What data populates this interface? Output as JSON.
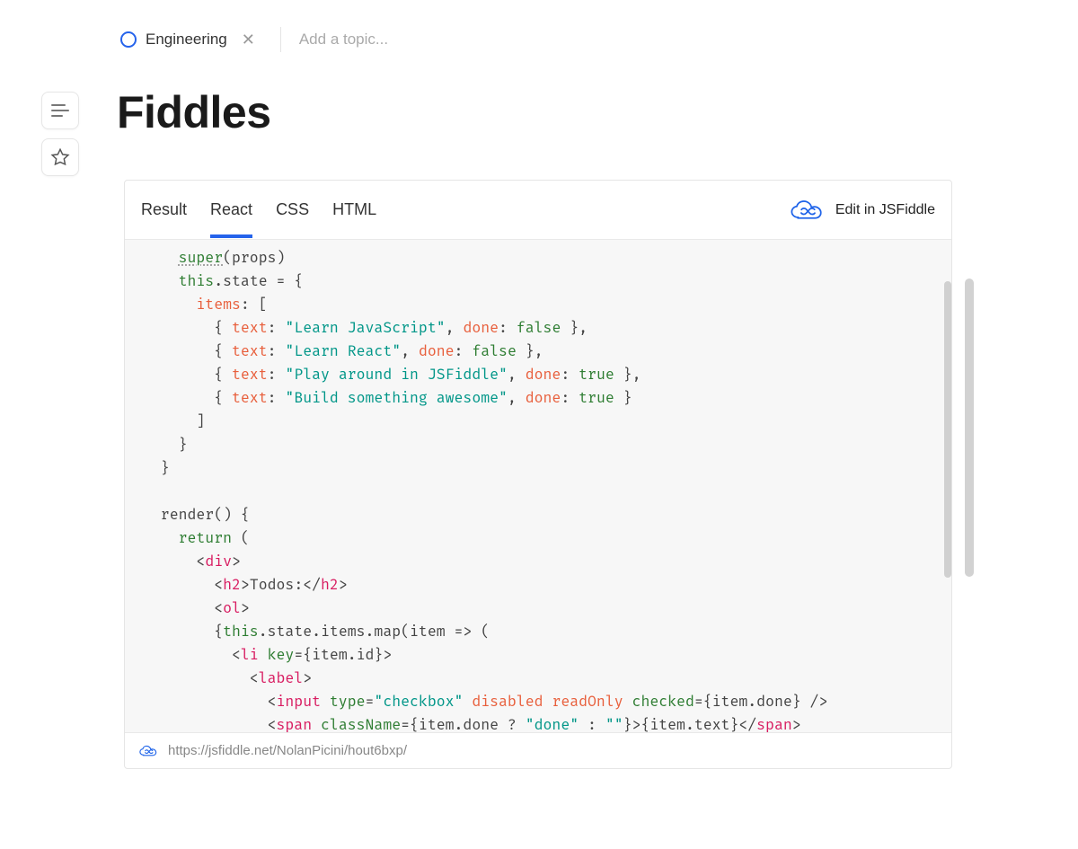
{
  "topic": {
    "label": "Engineering",
    "add_placeholder": "Add a topic..."
  },
  "title": "Fiddles",
  "fiddle": {
    "tabs": [
      "Result",
      "React",
      "CSS",
      "HTML"
    ],
    "active_tab": "React",
    "edit_label": "Edit in JSFiddle",
    "url": "https://jsfiddle.net/NolanPicini/hout6bxp/",
    "code": {
      "lines": [
        "    super(props)",
        "    this.state = {",
        "      items: [",
        "        { text: \"Learn JavaScript\", done: false },",
        "        { text: \"Learn React\", done: false },",
        "        { text: \"Play around in JSFiddle\", done: true },",
        "        { text: \"Build something awesome\", done: true }",
        "      ]",
        "    }",
        "  }",
        "",
        "  render() {",
        "    return (",
        "      <div>",
        "        <h2>Todos:</h2>",
        "        <ol>",
        "        {this.state.items.map(item => (",
        "          <li key={item.id}>",
        "            <label>",
        "              <input type=\"checkbox\" disabled readOnly checked={item.done} />",
        "              <span className={item.done ? \"done\" : \"\"}>{item.text}</span>"
      ]
    }
  }
}
